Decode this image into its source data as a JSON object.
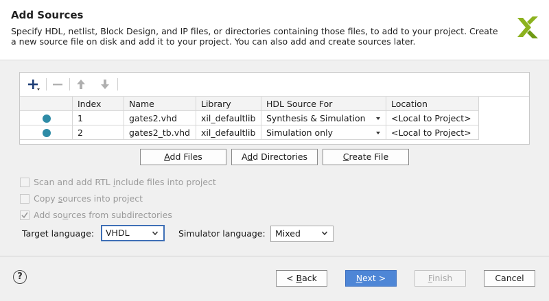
{
  "header": {
    "title": "Add Sources",
    "description": "Specify HDL, netlist, Block Design, and IP files, or directories containing those files, to add to your project. Create a new source file on disk and add it to your project. You can also add and create sources later."
  },
  "toolbar": {
    "add_icon": "plus-icon",
    "remove_icon": "minus-icon",
    "up_icon": "arrow-up-icon",
    "down_icon": "arrow-down-icon"
  },
  "table": {
    "columns": [
      "",
      "Index",
      "Name",
      "Library",
      "HDL Source For",
      "Location"
    ],
    "rows": [
      {
        "index": "1",
        "name": "gates2.vhd",
        "library": "xil_defaultlib",
        "hdl_source_for": "Synthesis & Simulation",
        "location": "<Local to Project>"
      },
      {
        "index": "2",
        "name": "gates2_tb.vhd",
        "library": "xil_defaultlib",
        "hdl_source_for": "Simulation only",
        "location": "<Local to Project>"
      }
    ]
  },
  "buttons": {
    "add_files_u": "A",
    "add_files_rest": "dd Files",
    "add_dirs_pre": "A",
    "add_dirs_u": "d",
    "add_dirs_rest": "d Directories",
    "create_file_u": "C",
    "create_file_rest": "reate File"
  },
  "options": {
    "scan_pre": "Scan and add RTL ",
    "scan_u": "i",
    "scan_rest": "nclude files into project",
    "copy_pre": "Copy ",
    "copy_u": "s",
    "copy_rest": "ources into project",
    "add_sub_pre": "Add so",
    "add_sub_u": "u",
    "add_sub_rest": "rces from subdirectories"
  },
  "language": {
    "target_label": "Target language:",
    "target_value": "VHDL",
    "simulator_label": "Simulator language:",
    "simulator_value": "Mixed"
  },
  "footer": {
    "help": "?",
    "back_pre": "< ",
    "back_u": "B",
    "back_rest": "ack",
    "next_pre": "",
    "next_u": "N",
    "next_rest": "ext >",
    "finish_u": "F",
    "finish_rest": "inish",
    "cancel": "Cancel"
  },
  "colors": {
    "status_dot": "#2e8ba6",
    "primary": "#4e86d6",
    "focus": "#3e6fb6",
    "logo": "#8cb21e"
  }
}
